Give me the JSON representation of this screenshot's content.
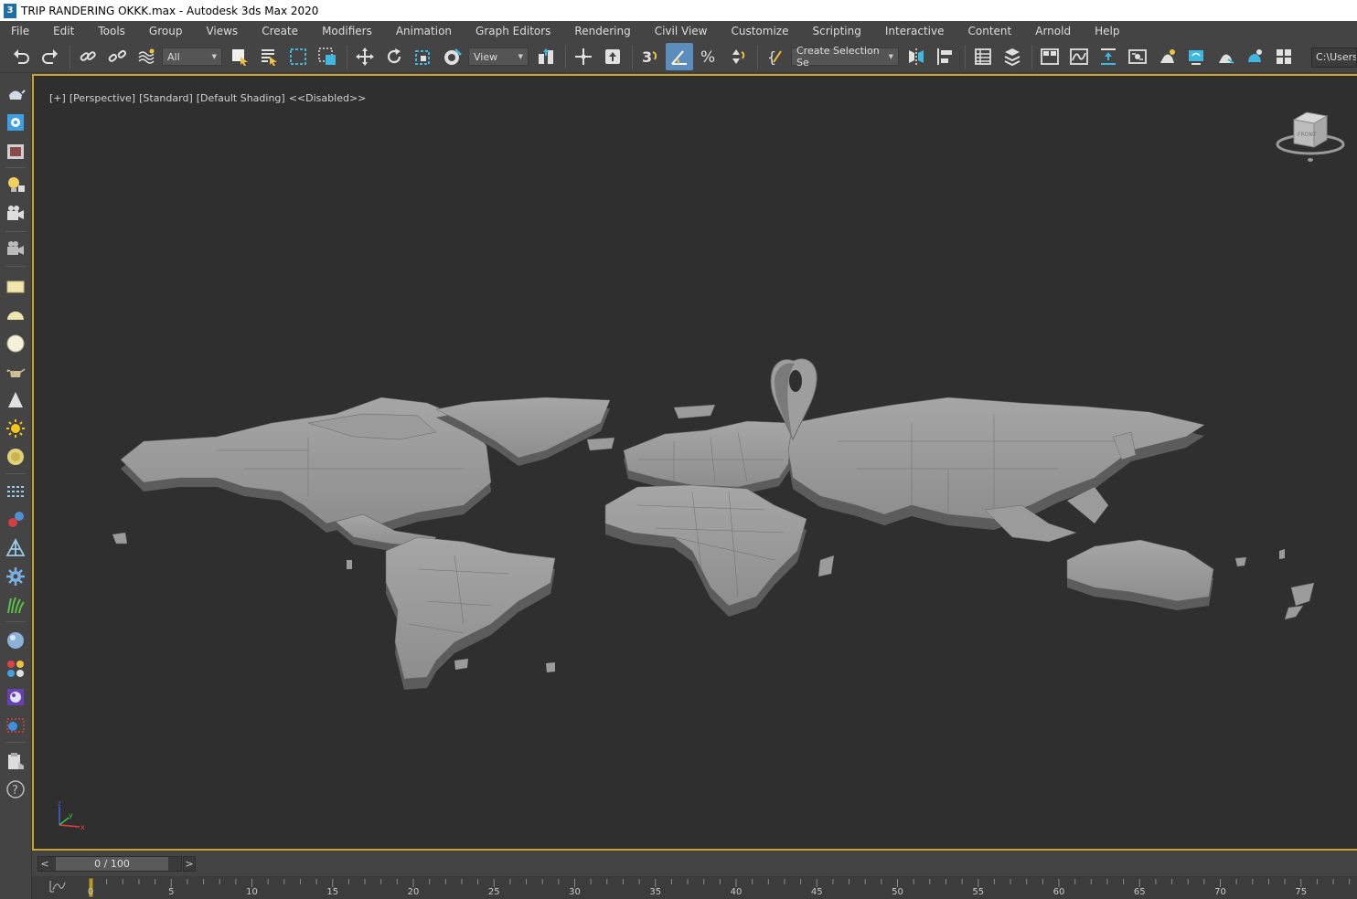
{
  "window": {
    "title": "TRIP RANDERING OKKK.max - Autodesk 3ds Max 2020",
    "app_icon_glyph": "3"
  },
  "menu": {
    "items": [
      "File",
      "Edit",
      "Tools",
      "Group",
      "Views",
      "Create",
      "Modifiers",
      "Animation",
      "Graph Editors",
      "Rendering",
      "Civil View",
      "Customize",
      "Scripting",
      "Interactive",
      "Content",
      "Arnold",
      "Help"
    ]
  },
  "toolbar": {
    "selection_filter": "All",
    "reference_coord": "View",
    "named_selection": "Create Selection Se",
    "path": "C:\\Users\\"
  },
  "viewport": {
    "label_plus": "[+]",
    "label_view": "[Perspective]",
    "label_style": "[Standard]",
    "label_shading": "[Default Shading]",
    "label_status": "<<Disabled>>",
    "viewcube_face": "FRONT",
    "axis_z": "z",
    "axis_y": "y",
    "axis_x": "x"
  },
  "timeline": {
    "frame_display": "0 / 100",
    "prev_label": "<",
    "next_label": ">",
    "current_frame": 0,
    "ticks": [
      "0",
      "5",
      "10",
      "15",
      "20",
      "25",
      "30",
      "35",
      "40",
      "45",
      "50",
      "55",
      "60",
      "65",
      "70",
      "75"
    ]
  },
  "colors": {
    "viewport_bg": "#2f2f2f",
    "active_border": "#c8a42c",
    "ui_bg": "#444444",
    "map_fill": "#9a9a9a",
    "map_side": "#5e5e5e"
  }
}
